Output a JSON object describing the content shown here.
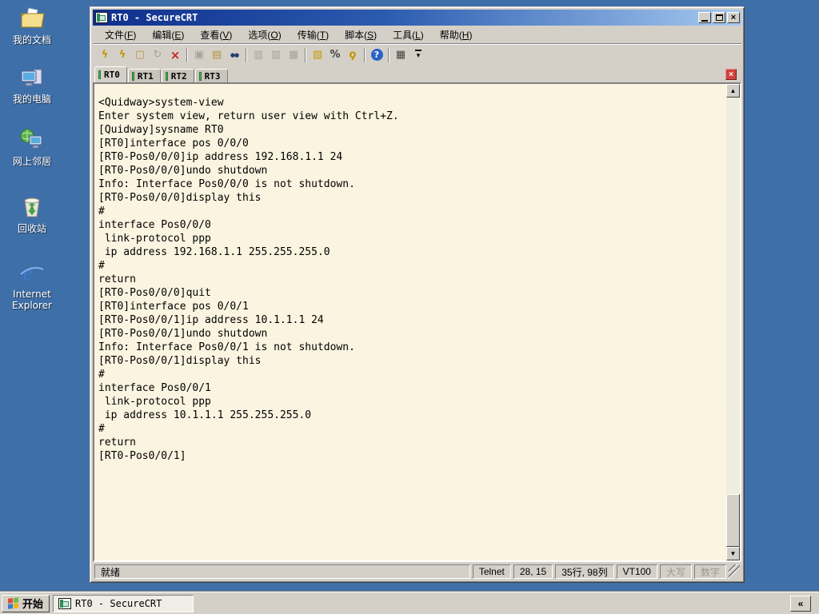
{
  "desktop": {
    "icons": [
      {
        "name": "my-documents",
        "label": "我的文档"
      },
      {
        "name": "my-computer",
        "label": "我的电脑"
      },
      {
        "name": "network-places",
        "label": "网上邻居"
      },
      {
        "name": "recycle-bin",
        "label": "回收站"
      },
      {
        "name": "internet-explorer",
        "label": "Internet Explorer"
      }
    ]
  },
  "window": {
    "title": "RT0 - SecureCRT",
    "controls": {
      "close_glyph": "×"
    },
    "menus": [
      "文件(F)",
      "编辑(E)",
      "查看(V)",
      "选项(O)",
      "传输(T)",
      "脚本(S)",
      "工具(L)",
      "帮助(H)"
    ],
    "toolbar": [
      {
        "name": "quick-connect",
        "glyph": "ϟ"
      },
      {
        "name": "connect",
        "glyph": "ϟ"
      },
      {
        "name": "new-session",
        "glyph": "▢"
      },
      {
        "name": "reconnect",
        "glyph": "↻"
      },
      {
        "name": "disconnect",
        "glyph": "×"
      },
      {
        "name": "copy",
        "glyph": "▣"
      },
      {
        "name": "paste",
        "glyph": "▤"
      },
      {
        "name": "find",
        "glyph": "●●"
      },
      {
        "name": "print-preview",
        "glyph": "▥"
      },
      {
        "name": "print-selection",
        "glyph": "▥"
      },
      {
        "name": "print",
        "glyph": "▦"
      },
      {
        "name": "session-options",
        "glyph": "▧"
      },
      {
        "name": "global-options",
        "glyph": "%"
      },
      {
        "name": "key-generator",
        "glyph": "ϙ"
      },
      {
        "name": "help",
        "glyph": "?"
      },
      {
        "name": "keymap-editor",
        "glyph": "▦"
      },
      {
        "name": "toolbar-overflow",
        "glyph": "▾"
      }
    ],
    "tabs": [
      {
        "label": "RT0",
        "active": true
      },
      {
        "label": "RT1",
        "active": false
      },
      {
        "label": "RT2",
        "active": false
      },
      {
        "label": "RT3",
        "active": false
      }
    ],
    "terminal_text": [
      "<Quidway>system-view",
      "Enter system view, return user view with Ctrl+Z.",
      "[Quidway]sysname RT0",
      "[RT0]interface pos 0/0/0",
      "[RT0-Pos0/0/0]ip address 192.168.1.1 24",
      "[RT0-Pos0/0/0]undo shutdown",
      "Info: Interface Pos0/0/0 is not shutdown.",
      "[RT0-Pos0/0/0]display this",
      "#",
      "interface Pos0/0/0",
      " link-protocol ppp",
      " ip address 192.168.1.1 255.255.255.0",
      "#",
      "return",
      "[RT0-Pos0/0/0]quit",
      "[RT0]interface pos 0/0/1",
      "[RT0-Pos0/0/1]ip address 10.1.1.1 24",
      "[RT0-Pos0/0/1]undo shutdown",
      "Info: Interface Pos0/0/1 is not shutdown.",
      "[RT0-Pos0/0/1]display this",
      "#",
      "interface Pos0/0/1",
      " link-protocol ppp",
      " ip address 10.1.1.1 255.255.255.0",
      "#",
      "return",
      "[RT0-Pos0/0/1]"
    ],
    "status": {
      "ready": "就绪",
      "protocol": "Telnet",
      "cursor_pos": "28,  15",
      "screen_size": "35行, 98列",
      "emulation": "VT100",
      "caps_indicator": "大写",
      "num_indicator": "数字"
    },
    "colors": {
      "terminal_bg": "#FBF4E0",
      "desktop_bg": "#3F6FA8",
      "titlebar_left": "#0F2E8C",
      "titlebar_right": "#A6CAF0",
      "chrome": "#D4D0C8",
      "tab_led_green": "#4DB050",
      "tab_close_red": "#D24040"
    }
  },
  "taskbar": {
    "start_label": "开始",
    "task_label": "RT0 - SecureCRT",
    "overflow_glyph": "«"
  }
}
